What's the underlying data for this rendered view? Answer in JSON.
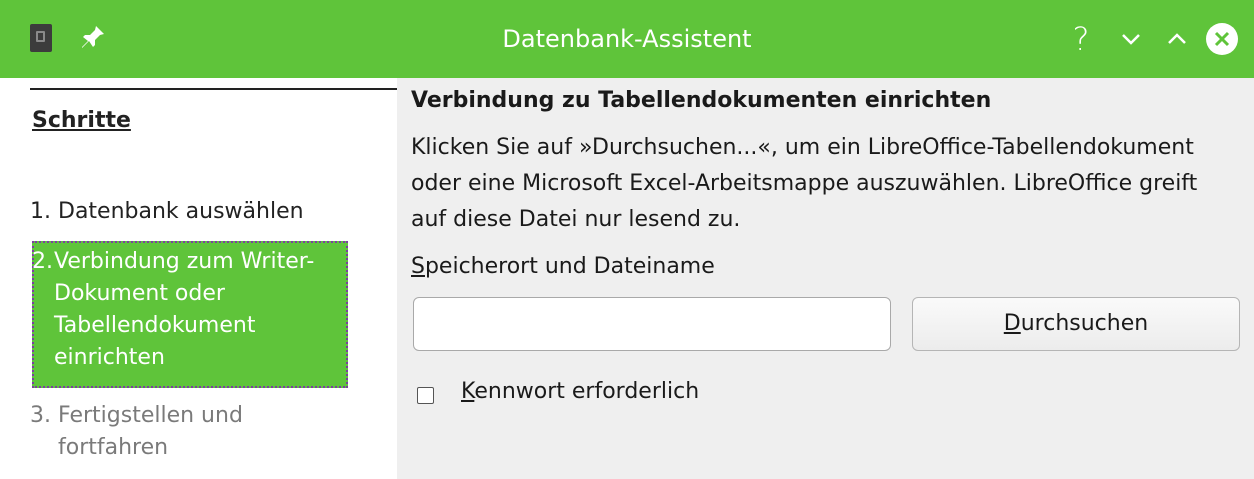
{
  "window": {
    "title": "Datenbank-Assistent",
    "help_label": "?",
    "icons": [
      "document-icon",
      "pin-icon",
      "help-icon",
      "minimize-icon",
      "maximize-icon",
      "close-icon"
    ],
    "colors": {
      "titlebar": "#5fc43a",
      "selection": "#5fc43a"
    }
  },
  "sidebar": {
    "heading": "Schritte",
    "steps": [
      {
        "number": "1.",
        "label": "Datenbank auswählen",
        "state": "done"
      },
      {
        "number": "2.",
        "label": "Verbindung zum Writer-Dokument oder Tabellendokument einrichten",
        "state": "current"
      },
      {
        "number": "3.",
        "label": "Fertigstellen und fortfahren",
        "state": "disabled"
      }
    ]
  },
  "main": {
    "heading": "Verbindung zu Tabellendokumenten einrichten",
    "description": "Klicken Sie auf »Durchsuchen...«, um ein LibreOffice-Tabellendokument oder eine Microsoft Excel-Arbeitsmappe auszuwählen. LibreOffice greift auf diese Datei nur lesend zu.",
    "location_label": {
      "mnemonic": "S",
      "rest": "peicherort und Dateiname"
    },
    "location_value": "",
    "browse_button": {
      "mnemonic": "D",
      "rest": "urchsuchen"
    },
    "password_checkbox": {
      "mnemonic": "K",
      "rest": "ennwort erforderlich",
      "checked": false
    }
  }
}
